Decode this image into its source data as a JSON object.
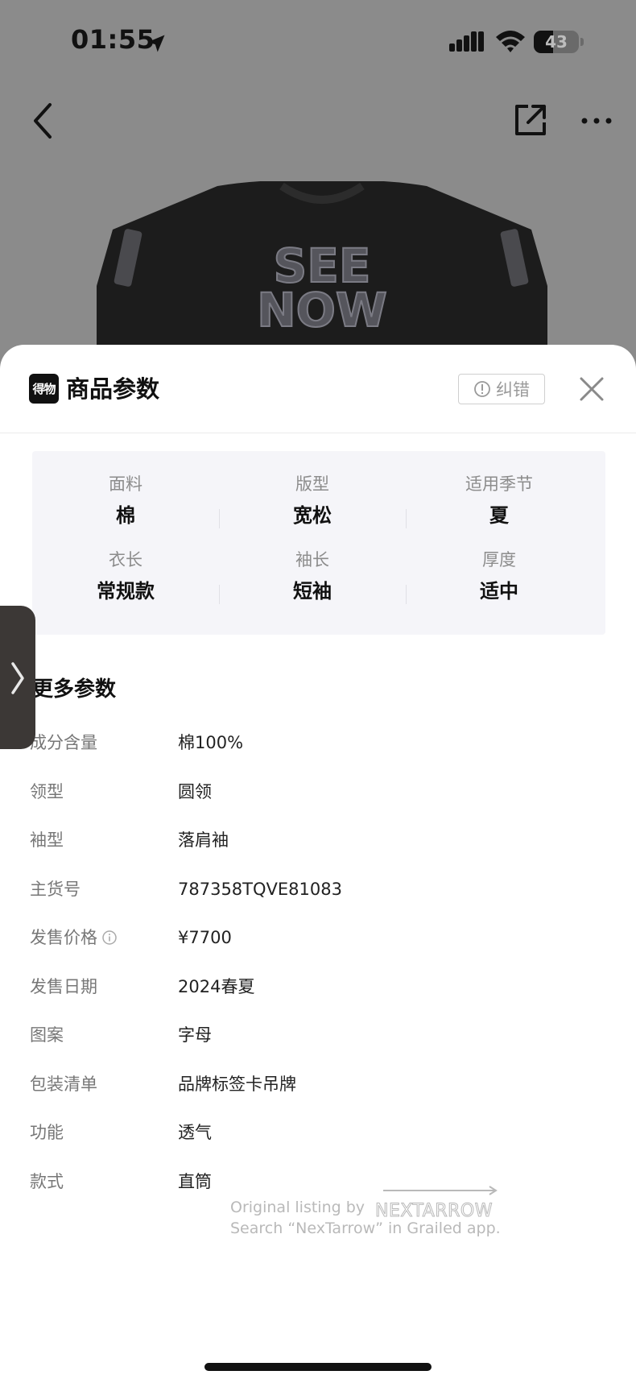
{
  "status_bar": {
    "time": "01:55",
    "battery_level": "43",
    "battery_fraction": 0.43
  },
  "nav": {
    "back_icon": "chevron-left-icon",
    "share_icon": "share-icon",
    "more_icon": "more-icon"
  },
  "product_image": {
    "print_line1": "SEE",
    "print_line2": "NOW"
  },
  "sheet": {
    "brand_logo_text": "得物",
    "title": "商品参数",
    "report_label": "纠错",
    "close_icon": "close-icon"
  },
  "key_params": [
    {
      "label": "面料",
      "value": "棉"
    },
    {
      "label": "版型",
      "value": "宽松"
    },
    {
      "label": "适用季节",
      "value": "夏"
    },
    {
      "label": "衣长",
      "value": "常规款"
    },
    {
      "label": "袖长",
      "value": "短袖"
    },
    {
      "label": "厚度",
      "value": "适中"
    }
  ],
  "more_params": {
    "title": "更多参数",
    "rows": [
      {
        "label": "成分含量",
        "value": "棉100%"
      },
      {
        "label": "领型",
        "value": "圆领"
      },
      {
        "label": "袖型",
        "value": "落肩袖"
      },
      {
        "label": "主货号",
        "value": "787358TQVE81083"
      },
      {
        "label": "发售价格",
        "value": "¥7700"
      },
      {
        "label": "发售日期",
        "value": "2024春夏"
      },
      {
        "label": "图案",
        "value": "字母"
      },
      {
        "label": "包装清单",
        "value": "品牌标签卡吊牌"
      },
      {
        "label": "功能",
        "value": "透气"
      },
      {
        "label": "款式",
        "value": "直筒"
      }
    ]
  },
  "watermark": {
    "line1": "Original listing by",
    "line2": "Search “NexTarrow” in Grailed app.",
    "logo": "NEXTARROW"
  },
  "colors": {
    "dim_background": "#8b8b8b",
    "sheet_background": "#ffffff",
    "grid_background": "#f5f5f9",
    "primary_text": "#111111",
    "secondary_text": "#8c8c8c"
  }
}
